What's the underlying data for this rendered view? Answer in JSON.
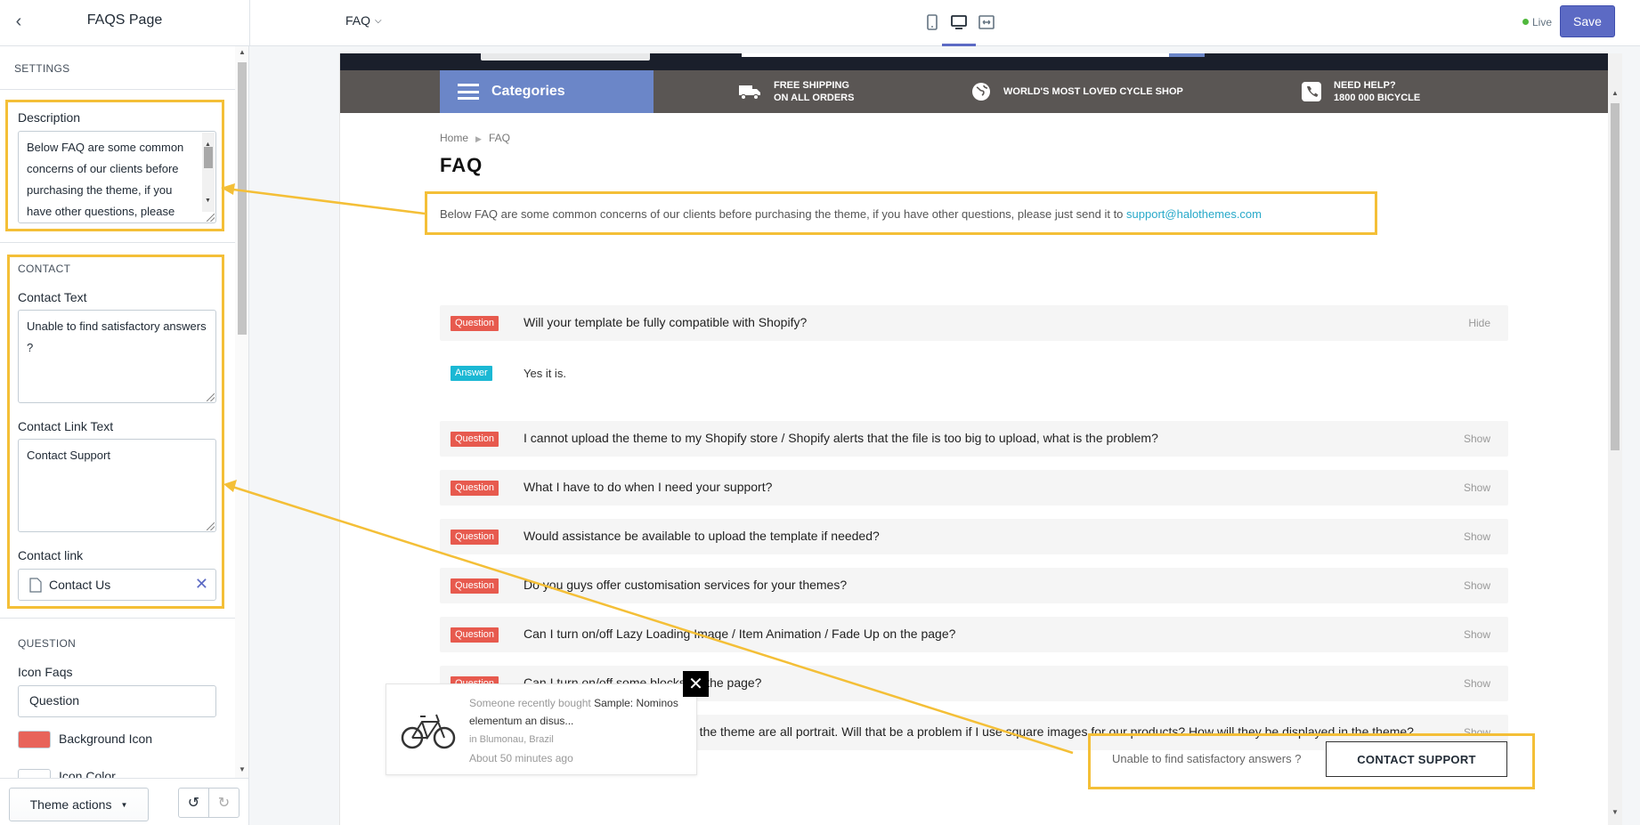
{
  "topbar": {
    "panel_title": "FAQS Page",
    "page_select": "FAQ",
    "status": "Live",
    "save_label": "Save",
    "devices": [
      "mobile",
      "desktop",
      "fullscreen"
    ]
  },
  "sidebar": {
    "settings_header": "SETTINGS",
    "description_label": "Description",
    "description_value": "Below FAQ are some common concerns of our clients before purchasing the theme, if you have other questions, please",
    "contact_header": "CONTACT",
    "contact_text_label": "Contact Text",
    "contact_text_value": "Unable to find satisfactory answers ?",
    "contact_link_text_label": "Contact Link Text",
    "contact_link_text_value": "Contact Support",
    "contact_link_label": "Contact link",
    "contact_link_value": "Contact Us",
    "question_header": "QUESTION",
    "icon_faqs_label": "Icon Faqs",
    "icon_faqs_value": "Question",
    "background_icon_label": "Background Icon",
    "background_icon_color": "#e8635a",
    "icon_color_label": "Icon Color",
    "icon_color_value": "#ffffff",
    "theme_actions_label": "Theme actions"
  },
  "preview": {
    "nav": {
      "categories": "Categories",
      "shipping_1": "FREE SHIPPING",
      "shipping_2": "ON ALL ORDERS",
      "loved": "WORLD'S MOST LOVED CYCLE SHOP",
      "help_1": "NEED HELP?",
      "help_2": "1800 000 BICYCLE"
    },
    "breadcrumb": {
      "home": "Home",
      "current": "FAQ"
    },
    "title": "FAQ",
    "description": "Below FAQ are some common concerns of our clients before purchasing the theme, if you have other questions, please just send it to",
    "email": "support@halothemes.com",
    "question_badge": "Question",
    "answer_badge": "Answer",
    "faqs": [
      {
        "q": "Will your template be fully compatible with Shopify?",
        "toggle": "Hide",
        "answer": "Yes it is."
      },
      {
        "q": "I cannot upload the theme to my Shopify store / Shopify alerts that the file is too big to upload, what is the problem?",
        "toggle": "Show"
      },
      {
        "q": "What I have to do when I need your support?",
        "toggle": "Show"
      },
      {
        "q": "Would assistance be available to upload the template if needed?",
        "toggle": "Show"
      },
      {
        "q": "Do you guys offer customisation services for your themes?",
        "toggle": "Show"
      },
      {
        "q": "Can I turn on/off Lazy Loading Image / Item Animation / Fade Up on the page?",
        "toggle": "Show"
      },
      {
        "q": "Can I turn on/off some blocks on the page?",
        "toggle": "Show"
      },
      {
        "q": "I notice that the images used in the theme are all portrait. Will that be a problem if I use square images for our products? How will they be displayed in the theme?",
        "toggle": "Show"
      }
    ],
    "popup": {
      "prefix": "Someone recently bought",
      "product": "Sample: Nominos elementum an disus...",
      "location": "in Blumonau, Brazil",
      "time": "About 50 minutes ago"
    },
    "contact_text": "Unable to find satisfactory answers ?",
    "contact_button": "CONTACT SUPPORT"
  },
  "colors": {
    "accent": "#5c6ac4",
    "highlight": "#f4bf37",
    "question_badge": "#e75a4e",
    "answer_badge": "#1bb8d4",
    "categories_bg": "#6b86c8",
    "link": "#28a9c9"
  }
}
